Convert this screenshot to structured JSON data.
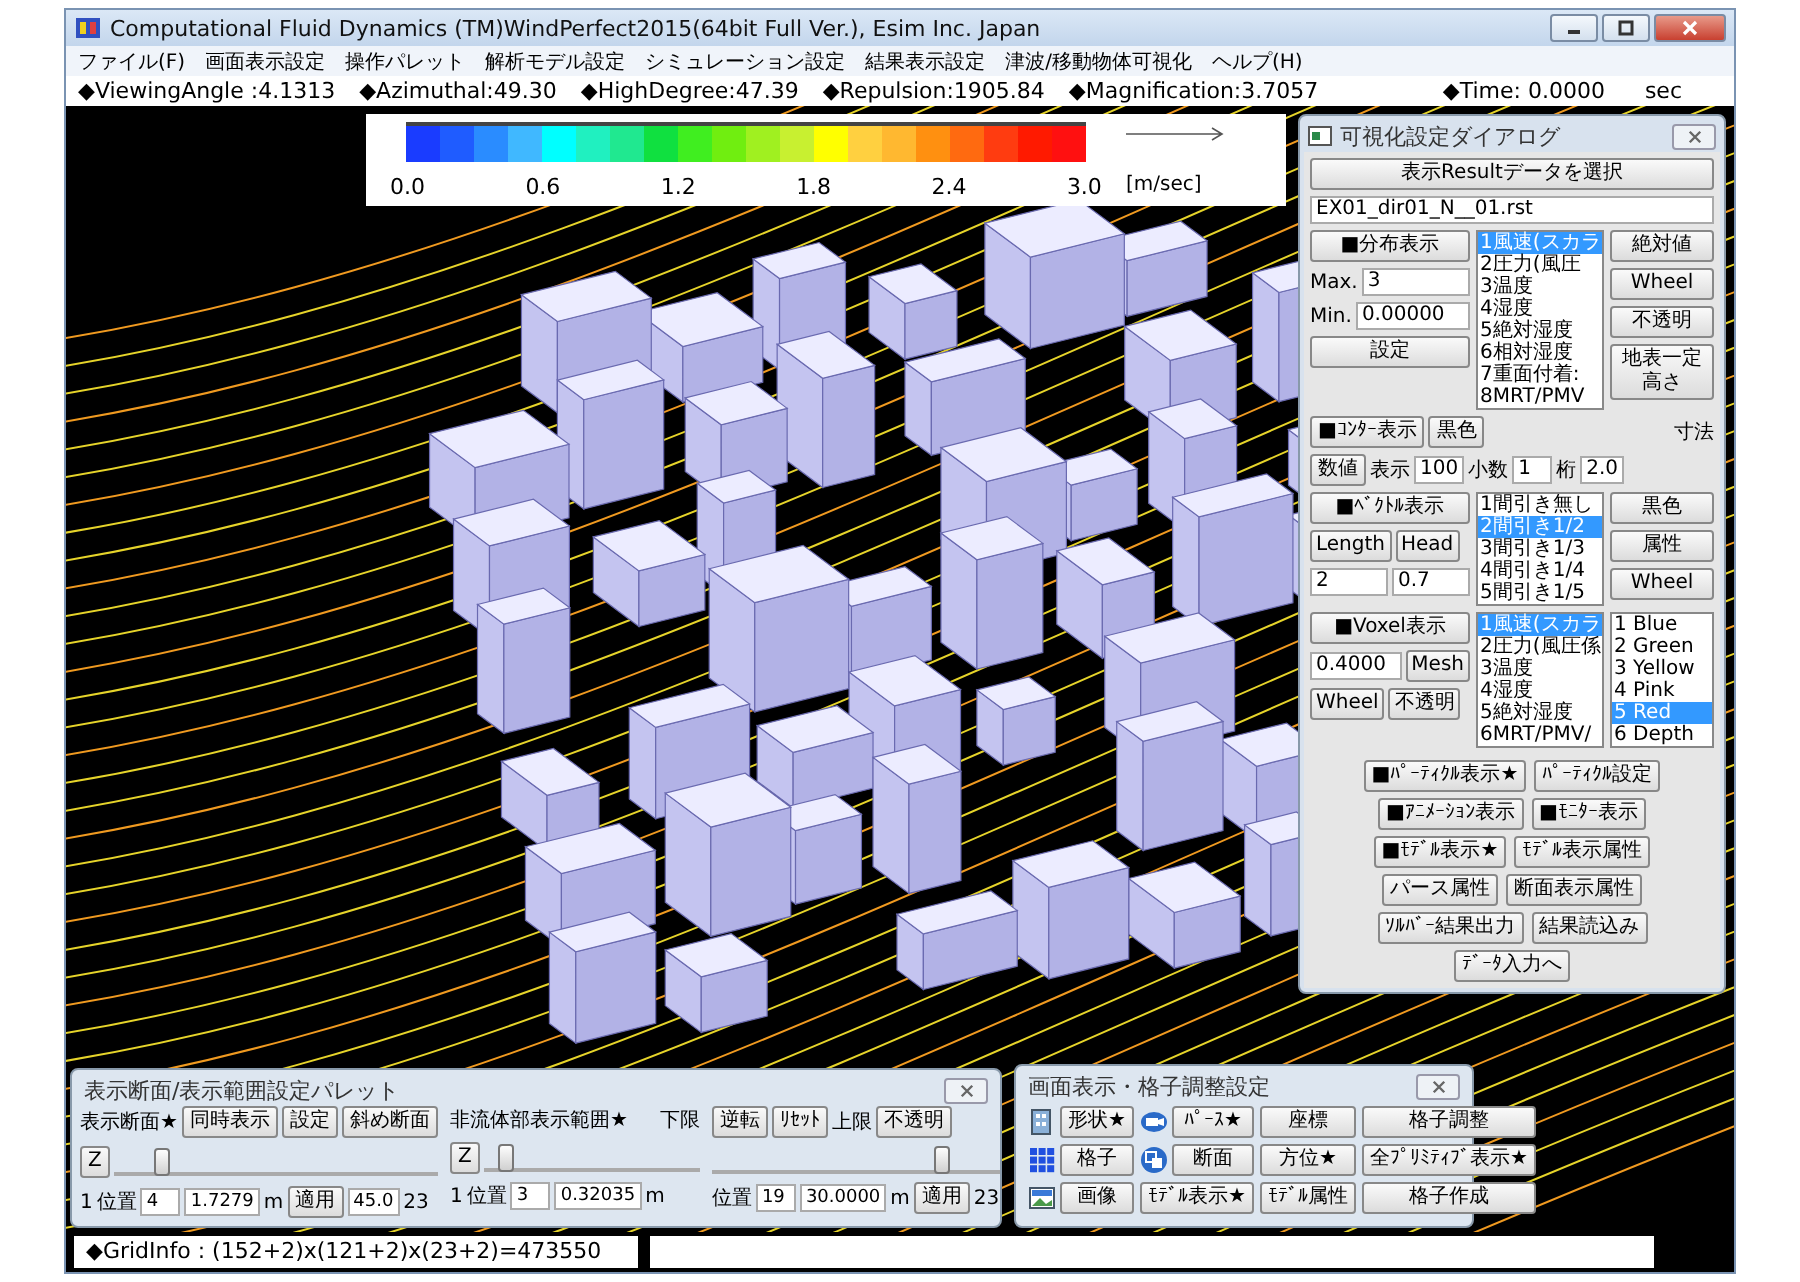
{
  "window": {
    "title": "Computational Fluid Dynamics (TM)WindPerfect2015(64bit Full Ver.), Esim Inc. Japan"
  },
  "menu": [
    "ファイル(F)",
    "画面表示設定",
    "操作パレット",
    "解析モデル設定",
    "シミュレーション設定",
    "結果表示設定",
    "津波/移動物体可視化",
    "ヘルプ(H)"
  ],
  "info_bar": {
    "items": [
      "◆ViewingAngle :4.1313",
      "◆Azimuthal:49.30",
      "◆HighDegree:47.39",
      "◆Repulsion:1905.84",
      "◆Magnification:3.7057"
    ],
    "time": "◆Time: 0.0000",
    "time_unit": "sec"
  },
  "legend": {
    "ticks": [
      "0.0",
      "0.6",
      "1.2",
      "1.8",
      "2.4",
      "3.0"
    ],
    "unit": "[m/sec]"
  },
  "dialog": {
    "title": "可視化設定ダイアログ",
    "select_button": "表示Resultデータを選択",
    "file": "EX01_dir01_N__01.rst",
    "distribution": {
      "button": "■分布表示",
      "max_label": "Max.",
      "max": "3",
      "min_label": "Min.",
      "min": "0.00000",
      "set_button": "設定",
      "items": [
        {
          "label": "1風速(スカラ",
          "selected": true
        },
        {
          "label": "2圧力(風圧",
          "selected": false
        },
        {
          "label": "3温度",
          "selected": false
        },
        {
          "label": "4湿度",
          "selected": false
        },
        {
          "label": "5絶対湿度",
          "selected": false
        },
        {
          "label": "6相対湿度",
          "selected": false
        },
        {
          "label": "7重面付着:",
          "selected": false
        },
        {
          "label": "8MRT/PMV",
          "selected": false
        }
      ],
      "buttons": [
        "絶対値",
        "Wheel",
        "不透明",
        "地表一定高さ"
      ]
    },
    "contour": {
      "button": "■ｺﾝﾀｰ表示",
      "color_button": "黒色",
      "size_label": "寸法",
      "value_button": "数値",
      "display_label": "表示",
      "display": "100",
      "decimal_label": "小数",
      "decimal": "1",
      "digits_label": "桁",
      "size": "2.0"
    },
    "vector": {
      "button": "■ﾍﾞｸﾄﾙ表示",
      "length_button": "Length",
      "head_button": "Head",
      "length": "2",
      "head": "0.7",
      "items": [
        {
          "label": "1間引き無し",
          "selected": false
        },
        {
          "label": "2間引き1/2",
          "selected": true
        },
        {
          "label": "3間引き1/3",
          "selected": false
        },
        {
          "label": "4間引き1/4",
          "selected": false
        },
        {
          "label": "5間引き1/5",
          "selected": false
        }
      ],
      "buttons": [
        "黒色",
        "属性",
        "Wheel"
      ]
    },
    "voxel": {
      "button": "■Voxel表示",
      "value": "0.4000",
      "mesh_button": "Mesh",
      "wheel_button": "Wheel",
      "opaque_button": "不透明",
      "items": [
        {
          "label": "1風速(スカラ",
          "selected": true
        },
        {
          "label": "2圧力(風圧係",
          "selected": false
        },
        {
          "label": "3温度",
          "selected": false
        },
        {
          "label": "4湿度",
          "selected": false
        },
        {
          "label": "5絶対湿度",
          "selected": false
        },
        {
          "label": "6MRT/PMV/",
          "selected": false
        }
      ],
      "colors": [
        {
          "label": "1 Blue",
          "selected": false
        },
        {
          "label": "2 Green",
          "selected": false
        },
        {
          "label": "3 Yellow",
          "selected": false
        },
        {
          "label": "4 Pink",
          "selected": false
        },
        {
          "label": "5 Red",
          "selected": true
        },
        {
          "label": "6 Depth",
          "selected": false
        }
      ]
    },
    "actions": [
      [
        "■ﾊﾟｰﾃｨｸﾙ表示★",
        "ﾊﾟｰﾃｨｸﾙ設定"
      ],
      [
        "■ｱﾆﾒｰｼｮﾝ表示",
        "■ﾓﾆﾀｰ表示"
      ],
      [
        "■ﾓﾃﾞﾙ表示★",
        "ﾓﾃﾞﾙ表示属性"
      ],
      [
        "パース属性",
        "断面表示属性"
      ],
      [
        "ｿﾙﾊﾞｰ結果出力",
        "結果読込み"
      ],
      [
        "ﾃﾞｰﾀ入力へ"
      ]
    ]
  },
  "section_palette": {
    "title": "表示断面/表示範囲設定パレット",
    "section": {
      "label": "表示断面★",
      "buttons": [
        "同時表示",
        "設定",
        "斜め断面"
      ],
      "axis_button": "Z",
      "level": 0.15,
      "start": "1",
      "position_label": "位置",
      "index": "4",
      "coordinate": "1.7279",
      "unit": "m",
      "apply_button": "適用",
      "angle": "45.0",
      "end": "23"
    },
    "range": {
      "label": "非流体部表示範囲★",
      "lower_label": "下限",
      "upper_label": "上限",
      "buttons": [
        "逆転",
        "ﾘｾｯﾄ"
      ],
      "opaque_button": "不透明",
      "axis_button": "Z",
      "sliders": [
        {
          "level": 0.1
        },
        {
          "level": 0.8
        }
      ],
      "start": "1",
      "lower_position_label": "位置",
      "lower_index": "3",
      "lower_coordinate": "0.32035",
      "lower_unit": "m",
      "upper_position_label": "位置",
      "upper_index": "19",
      "upper_coordinate": "30.0000",
      "upper_unit": "m",
      "apply_button": "適用",
      "end": "23"
    }
  },
  "display_palette": {
    "title": "画面表示・格子調整設定",
    "rows": [
      [
        "形状★",
        "ﾊﾟｰｽ★",
        "座標",
        "格子調整"
      ],
      [
        "格子",
        "断面",
        "方位★",
        "全ﾌﾟﾘﾐﾃｨﾌﾞ表示★"
      ],
      [
        "画像",
        "ﾓﾃﾞﾙ表示★",
        "ﾓﾃﾞﾙ属性",
        "格子作成"
      ]
    ]
  },
  "status_bar": {
    "grid_info": "◆GridInfo : (152+2)x(121+2)x(23+2)=473550"
  }
}
